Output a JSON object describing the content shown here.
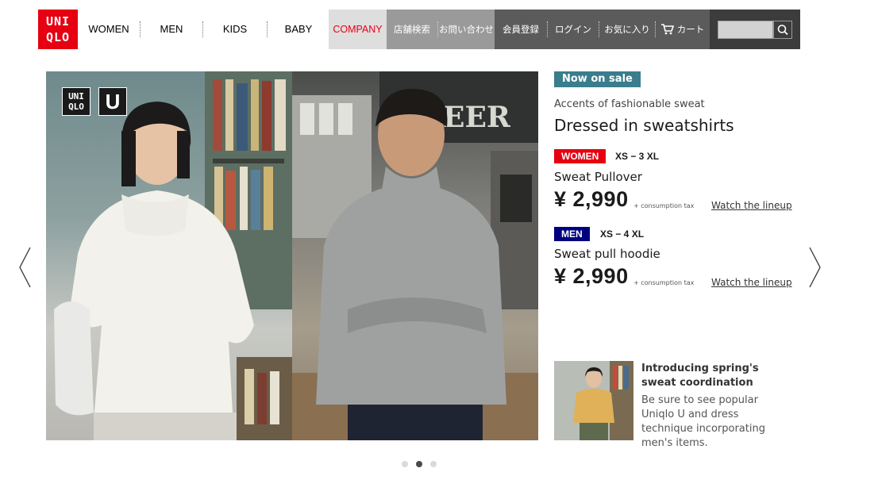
{
  "header": {
    "logo": {
      "line1": "UNI",
      "line2": "QLO",
      "color": "#e60012"
    },
    "nav": [
      {
        "label": "WOMEN"
      },
      {
        "label": "MEN"
      },
      {
        "label": "KIDS"
      },
      {
        "label": "BABY"
      }
    ],
    "company": {
      "label": "COMPANY"
    },
    "stores": [
      {
        "label": "店舗検索"
      },
      {
        "label": "お問い合わせ"
      }
    ],
    "member": [
      {
        "label": "会員登録"
      },
      {
        "label": "ログイン"
      },
      {
        "label": "お気に入り"
      },
      {
        "label": "カート",
        "icon": "cart-icon"
      }
    ],
    "search": {
      "placeholder": "",
      "icon": "search-icon"
    }
  },
  "hero": {
    "uq_logo": {
      "box1_line1": "UNI",
      "box1_line2": "QLO",
      "box2": "U"
    }
  },
  "info": {
    "badge": "Now on sale",
    "kicker": "Accents of fashionable sweat",
    "headline": "Dressed in sweatshirts",
    "products": {
      "women": {
        "tag": "WOMEN",
        "sizes": "XS − 3 XL",
        "name": "Sweat Pullover",
        "price": "¥ 2,990",
        "tax": "+ consumption tax",
        "link": "Watch the lineup"
      },
      "men": {
        "tag": "MEN",
        "sizes": "XS − 4 XL",
        "name": "Sweat pull hoodie",
        "price": "¥ 2,990",
        "tax": "+ consumption tax",
        "link": "Watch the lineup"
      }
    },
    "promo": {
      "title": "Introducing spring's sweat coordination",
      "text": "Be sure to see popular Uniqlo U and dress technique incorporating men's items."
    }
  },
  "carousel": {
    "slide_count": 3,
    "active_index": 1
  },
  "colors": {
    "brand_red": "#e60012",
    "sale_teal": "#3a7d8c",
    "men_navy": "#000080"
  }
}
